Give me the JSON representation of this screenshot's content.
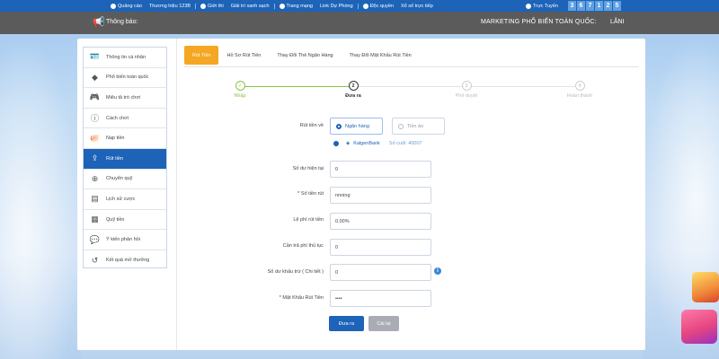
{
  "topbar": {
    "links": [
      {
        "icon": "info-icon",
        "label": "Quảng cáo"
      },
      {
        "icon": "",
        "label": "Thương hiệu 123B"
      },
      {
        "icon": "info-icon",
        "label": "Giới thi"
      },
      {
        "icon": "",
        "label": "Giải trí xanh sạch"
      },
      {
        "icon": "globe-icon",
        "label": "Trang mạng"
      },
      {
        "icon": "",
        "label": "Link Dự Phòng"
      },
      {
        "icon": "user-icon",
        "label": "Độc quyền"
      },
      {
        "icon": "",
        "label": "Xổ số trực tiếp"
      }
    ],
    "online_label": "Trực Tuyến",
    "online_digits": [
      "3",
      "6",
      "7",
      "1",
      "2",
      "5"
    ]
  },
  "notice": {
    "label": "Thông báo:",
    "marquee": "MARKETING PHỔ BIẾN TOÀN QUỐC:",
    "marquee_tail": "LÃNI"
  },
  "sidebar": {
    "items": [
      {
        "icon": "id-card-icon",
        "label": "Thông tin cá nhân"
      },
      {
        "icon": "diamond-icon",
        "label": "Phổ biến toàn quốc"
      },
      {
        "icon": "gamepad-icon",
        "label": "Miêu tả trò chơi"
      },
      {
        "icon": "info-circle-icon",
        "label": "Cách chơi"
      },
      {
        "icon": "piggy-bank-icon",
        "label": "Nạp tiền"
      },
      {
        "icon": "withdraw-icon",
        "label": "Rút tiền",
        "active": true
      },
      {
        "icon": "coin-transfer-icon",
        "label": "Chuyển quỹ"
      },
      {
        "icon": "document-icon",
        "label": "Lịch sử cược"
      },
      {
        "icon": "fund-icon",
        "label": "Quỹ tiền"
      },
      {
        "icon": "chat-icon",
        "label": "Ý kiến phản hồi"
      },
      {
        "icon": "history-icon",
        "label": "Kết quả mở thưởng"
      }
    ]
  },
  "tabs": [
    {
      "label": "Rút Tiền",
      "active": true
    },
    {
      "label": "Hồ Sơ Rút Tiền"
    },
    {
      "label": "Thay Đổi Thẻ Ngân Hàng"
    },
    {
      "label": "Thay Đổi Mật Khẩu Rút Tiền"
    }
  ],
  "steps": [
    {
      "num": "✓",
      "label": "Nhập",
      "state": "done"
    },
    {
      "num": "2",
      "label": "Đưa ra",
      "state": "current"
    },
    {
      "num": "3",
      "label": "Phê duyệt",
      "state": "todo"
    },
    {
      "num": "4",
      "label": "Hoàn thành",
      "state": "todo"
    }
  ],
  "form": {
    "withdraw_to_label": "Rút tiền về",
    "option_bank": "Ngân hàng",
    "option_coin": "Tiền ảo",
    "bank_name": "KalgenBank",
    "bank_tail": "Số cuối: 40007",
    "balance_label": "Số dư hiện tại",
    "balance_value": "0",
    "amount_label": "* Số tiền rút",
    "amount_value": "nnning",
    "fee_rate_label": "Lệ phí rút tiền",
    "fee_rate_value": "0.00%",
    "fee_label": "Cần trả phí thủ tục",
    "fee_value": "0",
    "deduct_label": "Số dư khấu trừ ( Chi tiết )",
    "deduct_value": "0",
    "password_label": "* Mật Khẩu Rút Tiền",
    "password_value": "••••",
    "submit_label": "Đưa ra",
    "reset_label": "Cài lại"
  },
  "colors": {
    "brand_blue": "#1d63b8",
    "accent_orange": "#f5a623",
    "done_green": "#8bc34a"
  }
}
